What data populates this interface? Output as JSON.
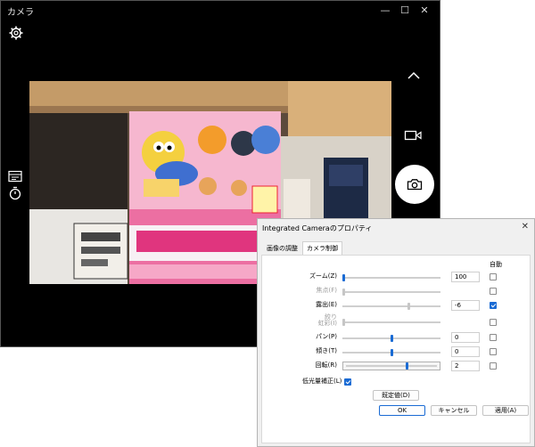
{
  "camera": {
    "title": "カメラ",
    "window_controls": {
      "minimize": "—",
      "maximize": "☐",
      "close": "✕"
    }
  },
  "dialog": {
    "title": "Integrated Cameraのプロパティ",
    "close": "✕",
    "tabs": [
      "画像の調整",
      "カメラ制御"
    ],
    "auto_header": "自動",
    "rows": [
      {
        "label": "ズーム(Z)",
        "value": "100",
        "level": 0.0,
        "auto": false,
        "disabled": false
      },
      {
        "label": "焦点(F)",
        "value": "",
        "level": 0.0,
        "auto": false,
        "disabled": true
      },
      {
        "label": "露出(E)",
        "value": "-6",
        "level": 0.68,
        "auto": true,
        "disabled": false
      },
      {
        "label": "絞り\n虹彩(I)",
        "value": "",
        "level": 0.0,
        "auto": false,
        "disabled": true
      },
      {
        "label": "パン(P)",
        "value": "0",
        "level": 0.5,
        "auto": false,
        "disabled": false
      },
      {
        "label": "傾き(T)",
        "value": "0",
        "level": 0.5,
        "auto": false,
        "disabled": false
      },
      {
        "label": "回転(R)",
        "value": "2",
        "level": 0.67,
        "auto": false,
        "disabled": false
      }
    ],
    "low_light": {
      "label": "低光量補正(L)",
      "checked": true
    },
    "default_button": "既定値(D)",
    "ok": "OK",
    "cancel": "キャンセル",
    "apply": "適用(A)"
  }
}
